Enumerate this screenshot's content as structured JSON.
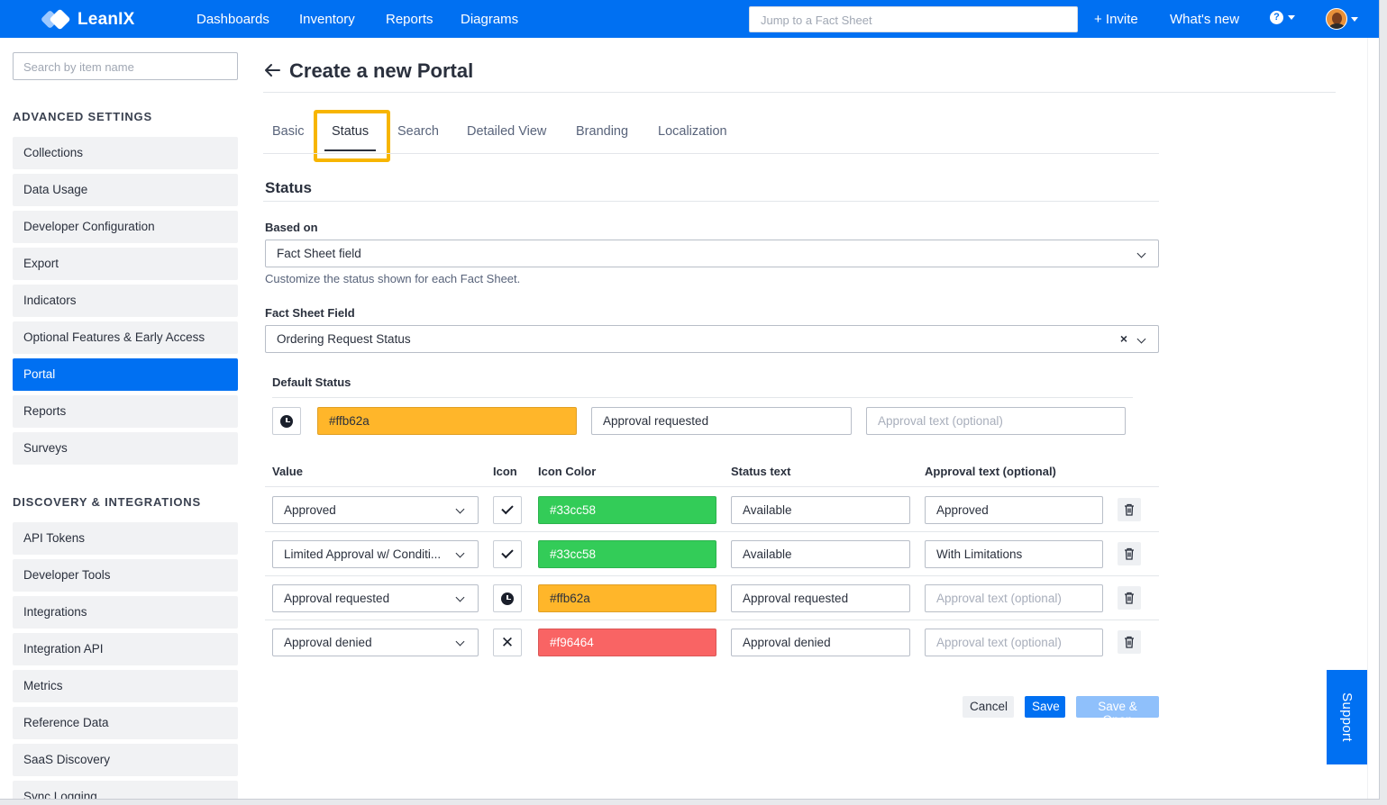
{
  "topbar": {
    "logo": "LeanIX",
    "nav": [
      "Dashboards",
      "Inventory",
      "Reports",
      "Diagrams"
    ],
    "jump_placeholder": "Jump to a Fact Sheet",
    "invite": "+ Invite",
    "whats_new": "What's new",
    "help_glyph": "?"
  },
  "sidebar": {
    "search_placeholder": "Search by item name",
    "advanced_heading": "ADVANCED SETTINGS",
    "advanced_items": [
      "Collections",
      "Data Usage",
      "Developer Configuration",
      "Export",
      "Indicators",
      "Optional Features & Early Access",
      "Portal",
      "Reports",
      "Surveys"
    ],
    "active_item": "Portal",
    "discovery_heading": "DISCOVERY & INTEGRATIONS",
    "discovery_items": [
      "API Tokens",
      "Developer Tools",
      "Integrations",
      "Integration API",
      "Metrics",
      "Reference Data",
      "SaaS Discovery",
      "Sync Logging"
    ]
  },
  "main": {
    "title": "Create a new Portal",
    "tabs": [
      "Basic",
      "Status",
      "Search",
      "Detailed View",
      "Branding",
      "Localization"
    ],
    "active_tab": "Status",
    "section_title": "Status",
    "based_on_label": "Based on",
    "based_on_value": "Fact Sheet field",
    "based_on_help": "Customize the status shown for each Fact Sheet.",
    "fs_field_label": "Fact Sheet Field",
    "fs_field_value": "Ordering Request Status",
    "default_status_label": "Default Status",
    "default_status": {
      "icon": "clock-icon",
      "color": "#ffb62a",
      "status_text": "Approval requested",
      "approval_placeholder": "Approval text (optional)"
    },
    "table_headers": [
      "Value",
      "Icon",
      "Icon Color",
      "Status text",
      "Approval text (optional)"
    ],
    "rows": [
      {
        "value": "Approved",
        "icon": "check-icon",
        "color": "#33cc58",
        "status_text": "Available",
        "approval_text": "Approved"
      },
      {
        "value": "Limited Approval w/ Conditi...",
        "icon": "check-icon",
        "color": "#33cc58",
        "status_text": "Available",
        "approval_text": "With Limitations"
      },
      {
        "value": "Approval requested",
        "icon": "clock-icon",
        "color": "#ffb62a",
        "status_text": "Approval requested",
        "approval_text": ""
      },
      {
        "value": "Approval denied",
        "icon": "close-icon",
        "color": "#f96464",
        "status_text": "Approval denied",
        "approval_text": ""
      }
    ],
    "approval_placeholder": "Approval text (optional)",
    "buttons": {
      "cancel": "Cancel",
      "save": "Save",
      "save_open": "Save & Open"
    }
  },
  "support_label": "Support"
}
